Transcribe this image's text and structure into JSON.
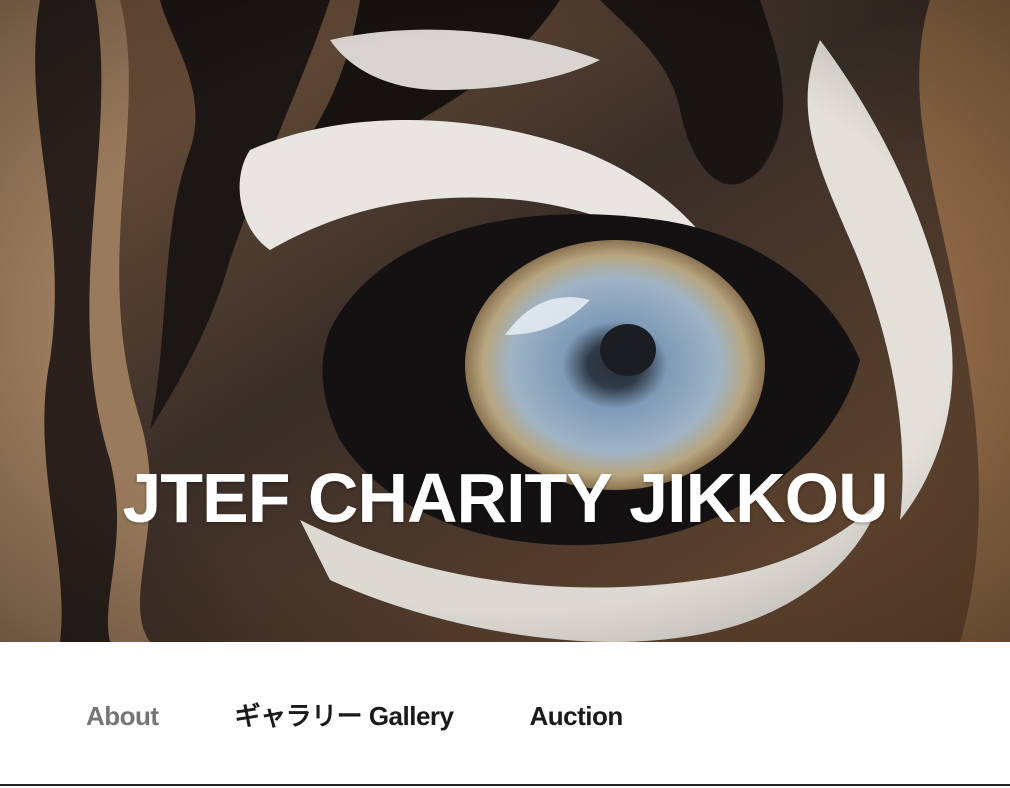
{
  "header": {
    "site_title": "JTEF CHARITY JIKKOU",
    "image_subject": "tiger-eye-photo"
  },
  "nav": {
    "items": [
      {
        "label": "About",
        "current": true
      },
      {
        "label": "ギャラリー Gallery",
        "current": false
      },
      {
        "label": "Auction",
        "current": false
      }
    ]
  },
  "colors": {
    "title_text": "#ffffff",
    "nav_text": "#1a1a1a",
    "nav_current": "#767676",
    "rule": "#222222"
  }
}
